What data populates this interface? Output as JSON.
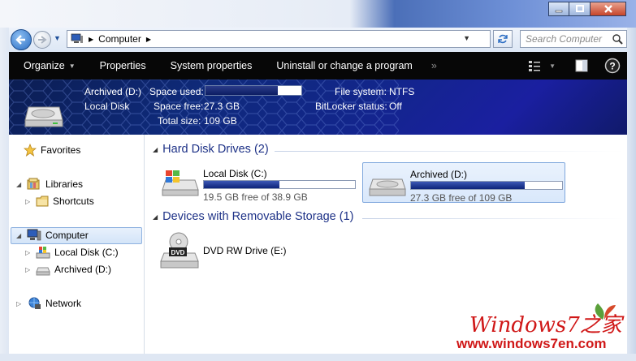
{
  "address": {
    "path": "Computer",
    "search_placeholder": "Search Computer"
  },
  "toolbar": {
    "organize": "Organize",
    "properties": "Properties",
    "system_properties": "System properties",
    "uninstall": "Uninstall or change a program",
    "more": "»"
  },
  "details": {
    "drive_name": "Archived (D:)",
    "drive_type": "Local Disk",
    "space_used_label": "Space used:",
    "space_used_fraction": 0.75,
    "space_free_label": "Space free:",
    "space_free_value": "27.3 GB",
    "total_size_label": "Total size:",
    "total_size_value": "109 GB",
    "file_system_label": "File system:",
    "file_system_value": "NTFS",
    "bitlocker_label": "BitLocker status:",
    "bitlocker_value": "Off"
  },
  "nav": {
    "favorites": "Favorites",
    "libraries": "Libraries",
    "shortcuts": "Shortcuts",
    "computer": "Computer",
    "local_disk_c": "Local Disk (C:)",
    "archived_d": "Archived (D:)",
    "network": "Network"
  },
  "content": {
    "hard_disk_group": "Hard Disk Drives (2)",
    "removable_group": "Devices with Removable Storage (1)",
    "drives": [
      {
        "name": "Local Disk (C:)",
        "free_text": "19.5 GB free of 38.9 GB",
        "used_fraction": 0.5
      },
      {
        "name": "Archived (D:)",
        "free_text": "27.3 GB free of 109 GB",
        "used_fraction": 0.75
      }
    ],
    "dvd": {
      "name": "DVD RW Drive (E:)",
      "badge": "DVD"
    }
  },
  "watermark": {
    "brand": "Windows7之家",
    "url": "www.windows7en.com"
  },
  "colors": {
    "group_title": "#1e3287",
    "details_bg": "#12268a",
    "command_bar": "#070707"
  }
}
